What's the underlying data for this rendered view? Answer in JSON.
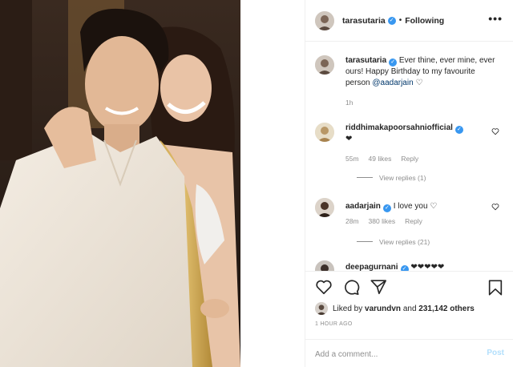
{
  "post": {
    "author": "tarasutaria",
    "follow_state": "Following",
    "more_icon": "more-horizontal-icon",
    "verified_icon": "verified-badge-icon"
  },
  "comments": [
    {
      "username": "tarasutaria",
      "text": "Ever thine, ever mine, ever ours! Happy Birthday to my favourite person ",
      "mention": "@aadarjain",
      "emoji": "♡",
      "time": "1h",
      "verified": true
    },
    {
      "username": "riddhimakapoorsahniofficial",
      "text": "❤",
      "time": "55m",
      "likes": "49 likes",
      "reply": "Reply",
      "view_replies": "View replies (1)",
      "verified": true
    },
    {
      "username": "aadarjain",
      "text": "I love you ♡",
      "time": "28m",
      "likes": "380 likes",
      "reply": "Reply",
      "view_replies": "View replies (21)",
      "verified": true
    },
    {
      "username": "deepagurnani",
      "text": "❤❤❤❤❤",
      "verified": true
    }
  ],
  "actions": {
    "like_icon": "heart-icon",
    "comment_icon": "comment-icon",
    "share_icon": "share-icon",
    "save_icon": "bookmark-icon"
  },
  "likes_summary": {
    "prefix": "Liked by ",
    "user": "varundvn",
    "middle": " and ",
    "count": "231,142 others"
  },
  "timestamp": "1 HOUR AGO",
  "add_comment": {
    "placeholder": "Add a comment...",
    "post_label": "Post"
  },
  "colors": {
    "link": "#00376b",
    "muted": "#8e8e8e",
    "verified": "#3897f0",
    "post_disabled": "#b2dffc"
  }
}
